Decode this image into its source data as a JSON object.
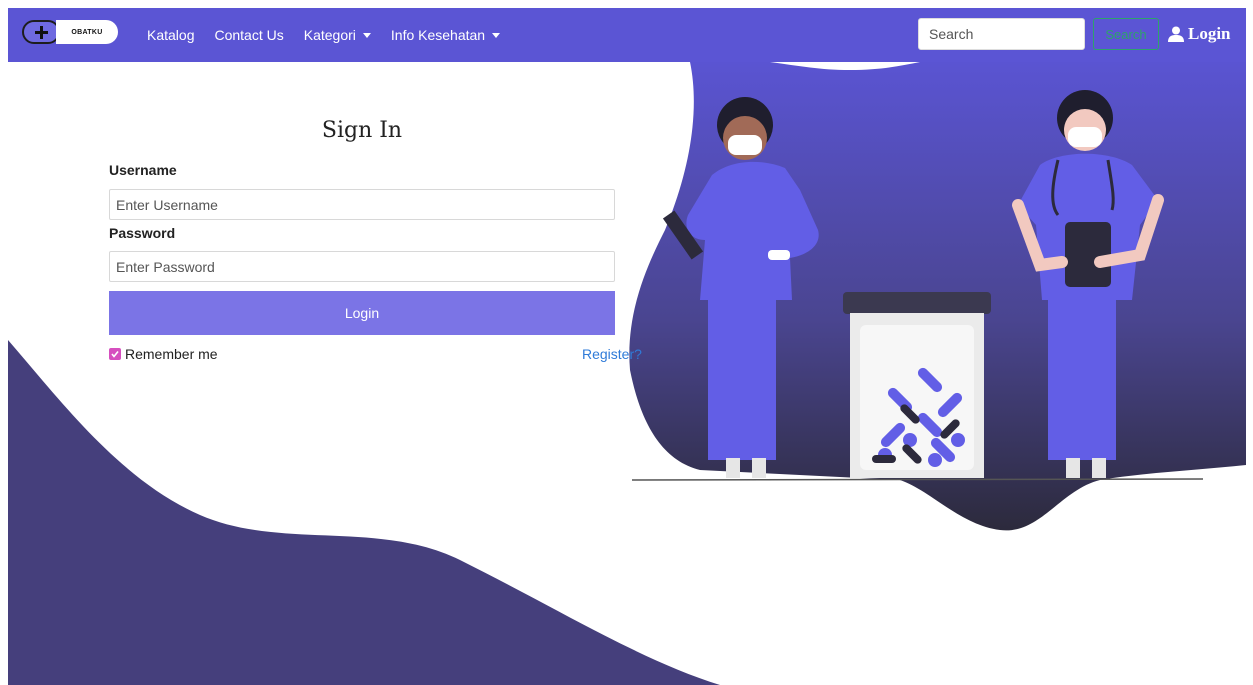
{
  "navbar": {
    "brand_text": "OBATKU",
    "links": [
      "Katalog",
      "Contact Us"
    ],
    "dropdowns": [
      "Kategori",
      "Info Kesehatan"
    ],
    "search_placeholder": "Search",
    "search_button": "Search",
    "login_label": "Login"
  },
  "form": {
    "title": "Sign In",
    "username_label": "Username",
    "username_placeholder": "Enter Username",
    "password_label": "Password",
    "password_placeholder": "Enter Password",
    "submit_label": "Login",
    "remember_label": "Remember me",
    "register_label": "Register?"
  },
  "colors": {
    "primary": "#5b55d4",
    "button": "#7b74e6",
    "wave_dark": "#453f7c",
    "link": "#2f7bd8",
    "checkbox": "#d64fbf"
  },
  "icons": {
    "logo": "plus-icon",
    "user": "user-icon",
    "checkbox": "check-icon"
  }
}
